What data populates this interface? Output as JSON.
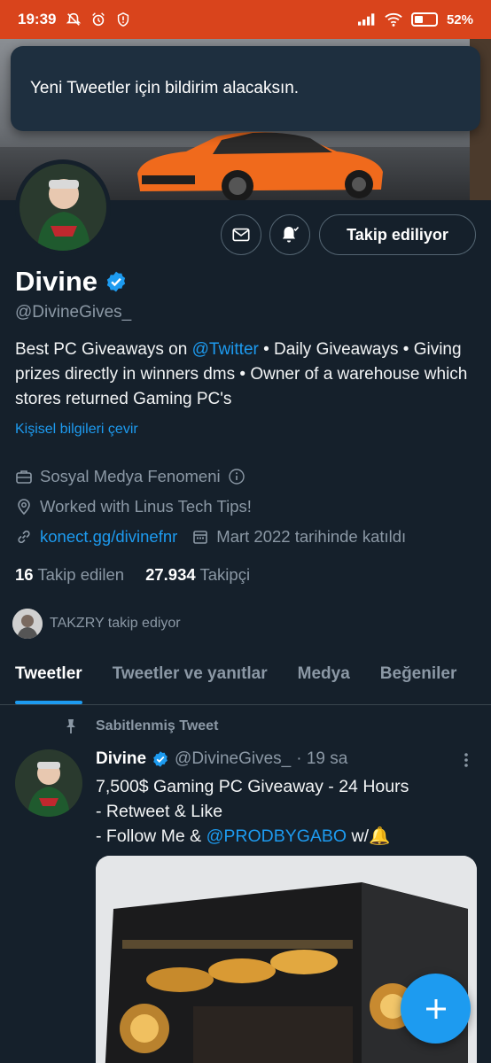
{
  "status_bar": {
    "time": "19:39",
    "battery": "52%",
    "battery_level": 0.52
  },
  "toast": {
    "message": "Yeni Tweetler için bildirim alacaksın."
  },
  "profile": {
    "display_name": "Divine",
    "handle": "@DivineGives_",
    "follow_button": "Takip ediliyor",
    "bio_parts": {
      "p1": "Best PC Giveaways on ",
      "mention": "@Twitter",
      "p2": " • Daily Giveaways • Giving prizes directly in winners dms • Owner of a warehouse which stores returned Gaming PC's"
    },
    "translate_link": "Kişisel bilgileri çevir",
    "category": "Sosyal Medya Fenomeni",
    "location": "Worked with Linus Tech Tips!",
    "website": "konect.gg/divinefnr",
    "joined": "Mart 2022 tarihinde katıldı",
    "following_count": "16",
    "following_label": "Takip edilen",
    "followers_count": "27.934",
    "followers_label": "Takipçi",
    "followed_by": "TAKZRY takip ediyor"
  },
  "tabs": [
    {
      "label": "Tweetler",
      "active": true
    },
    {
      "label": "Tweetler ve yanıtlar",
      "active": false
    },
    {
      "label": "Medya",
      "active": false
    },
    {
      "label": "Beğeniler",
      "active": false
    }
  ],
  "pinned_tweet": {
    "pinned_label": "Sabitlenmiş Tweet",
    "author_name": "Divine",
    "author_handle": "@DivineGives_",
    "time": "· 19 sa",
    "line1": "7,500$ Gaming PC Giveaway - 24 Hours",
    "line2": "- Retweet & Like",
    "line3_prefix": "- Follow Me & ",
    "line3_mention": "@PRODBYGABO",
    "line3_suffix": "  w/🔔"
  },
  "colors": {
    "background": "#15202b",
    "accent": "#1d9bf0",
    "status_bar": "#d9441c",
    "muted_text": "#8b98a5"
  },
  "icons": [
    "envelope-icon",
    "bell-notify-icon",
    "verified-badge-icon",
    "briefcase-icon",
    "location-pin-icon",
    "link-icon",
    "calendar-icon",
    "info-icon",
    "pin-icon",
    "more-vertical-icon",
    "compose-plus-icon"
  ]
}
